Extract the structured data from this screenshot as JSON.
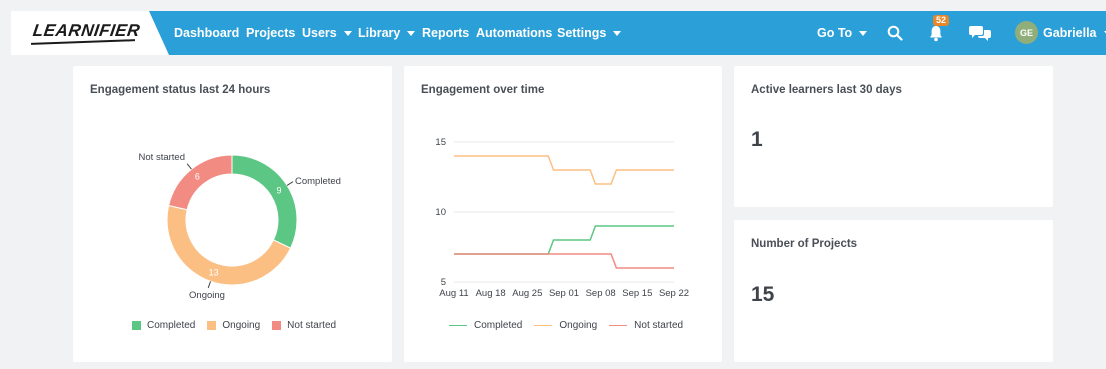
{
  "brand": {
    "logo_text": "LEARNIFIER"
  },
  "nav": {
    "dashboard": "Dashboard",
    "projects": "Projects",
    "users": "Users",
    "library": "Library",
    "reports": "Reports",
    "automations": "Automations",
    "settings": "Settings",
    "goto": "Go To",
    "notification_count": "52",
    "user_initials": "GE",
    "user_name": "Gabriella"
  },
  "colors": {
    "topbar": "#2b9fd8",
    "completed": "#5cc784",
    "ongoing": "#fbbf83",
    "not_started": "#f28b82"
  },
  "icons": [
    "search-icon",
    "bell-icon",
    "chat-icon",
    "chevron-down-icon"
  ],
  "cards": {
    "status": {
      "title": "Engagement status last 24 hours"
    },
    "time": {
      "title": "Engagement over time"
    },
    "learners": {
      "title": "Active learners last 30 days",
      "value": "1"
    },
    "projects": {
      "title": "Number of Projects",
      "value": "15"
    }
  },
  "chart_data": [
    {
      "type": "pie",
      "title": "Engagement status last 24 hours",
      "labels": [
        "Completed",
        "Ongoing",
        "Not started"
      ],
      "values": [
        9,
        13,
        6
      ],
      "colors": [
        "#5cc784",
        "#fbbf83",
        "#f28b82"
      ],
      "donut": true,
      "legend": "bottom"
    },
    {
      "type": "line",
      "title": "Engagement over time",
      "x_ticks": [
        "Aug 11",
        "Aug 18",
        "Aug 25",
        "Sep 01",
        "Sep 08",
        "Sep 15",
        "Sep 22"
      ],
      "y_ticks": [
        5,
        10,
        15
      ],
      "ylim": [
        5,
        16
      ],
      "grid": true,
      "legend": "bottom",
      "series": [
        {
          "name": "Completed",
          "color": "#5cc784",
          "x": [
            "Aug 11",
            "Aug 29",
            "Aug 30",
            "Sep 06",
            "Sep 07",
            "Sep 22"
          ],
          "values": [
            7,
            7,
            8,
            8,
            9,
            9
          ]
        },
        {
          "name": "Ongoing",
          "color": "#fbbf83",
          "x": [
            "Aug 11",
            "Aug 29",
            "Aug 30",
            "Sep 06",
            "Sep 07",
            "Sep 10",
            "Sep 11",
            "Sep 22"
          ],
          "values": [
            14,
            14,
            13,
            13,
            12,
            12,
            13,
            13
          ]
        },
        {
          "name": "Not started",
          "color": "#f28b82",
          "x": [
            "Aug 11",
            "Sep 10",
            "Sep 11",
            "Sep 22"
          ],
          "values": [
            7,
            7,
            6,
            6
          ]
        }
      ]
    }
  ]
}
